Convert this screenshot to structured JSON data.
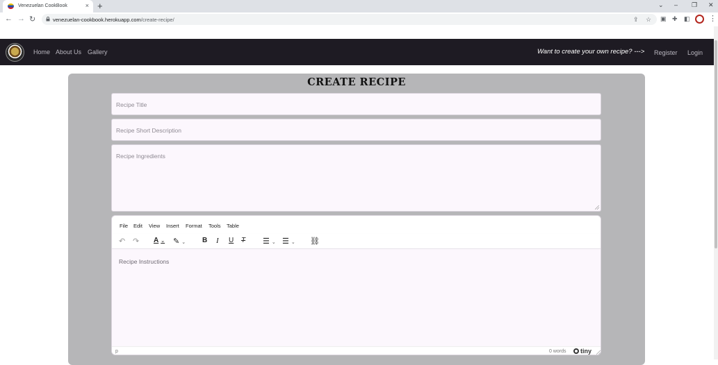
{
  "browser": {
    "tab_title": "Venezuelan CookBook",
    "tab_close": "×",
    "new_tab": "+",
    "url_host": "venezuelan-cookbook.herokuapp.com",
    "url_path": "/create-recipe/",
    "icons": [
      "back-arrow-icon",
      "forward-arrow-icon",
      "reload-icon",
      "lock-icon",
      "share-icon",
      "star-icon",
      "extension-icon",
      "puzzle-icon",
      "sidepanel-icon",
      "profile-icon",
      "kebab-menu-icon"
    ],
    "window_controls": [
      "⌄",
      "–",
      "❐",
      "✕"
    ]
  },
  "navbar": {
    "links": [
      "Home",
      "About Us",
      "Gallery"
    ],
    "cta": "Want to create your own recipe? --->",
    "register": "Register",
    "login": "Login"
  },
  "form": {
    "title": "CREATE RECIPE",
    "title_placeholder": "Recipe Title",
    "description_placeholder": "Recipe Short Description",
    "ingredients_placeholder": "Recipe Ingredients",
    "editor": {
      "menu": [
        "File",
        "Edit",
        "View",
        "Insert",
        "Format",
        "Tools",
        "Table"
      ],
      "instructions_placeholder": "Recipe Instructions",
      "status_path": "p",
      "word_count": "0 words",
      "brand": "tiny"
    }
  },
  "colors": {
    "navbar_bg": "#1e1b23",
    "card_bg": "#b6b6b8",
    "field_bg": "#fcf7fd",
    "nav_link": "#b9b6bf"
  }
}
